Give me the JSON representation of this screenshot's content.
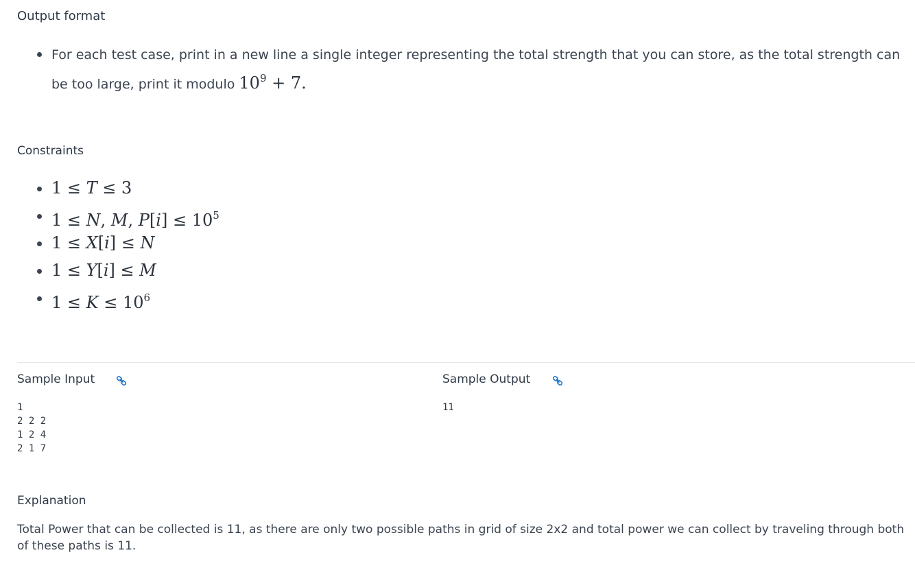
{
  "output_format": {
    "heading": "Output format",
    "bullet_text": "For each test case, print in a new line a single integer representing the total strength that you can store, as the total strength can be too large, print it modulo ",
    "modulo_expr": {
      "base": "10",
      "exponent": "9",
      "rest": " + 7",
      "end": "."
    }
  },
  "constraints": {
    "heading": "Constraints",
    "items": [
      "1 ≤ T ≤ 3",
      "1 ≤ N, M, P[i] ≤ 10^5",
      "1 ≤ X[i] ≤ N",
      "1 ≤ Y[i] ≤ M",
      "1 ≤ K ≤ 10^6"
    ]
  },
  "sample_input": {
    "heading": "Sample Input",
    "icon": "link-icon",
    "content": "1\n2 2 2\n1 2 4\n2 1 7"
  },
  "sample_output": {
    "heading": "Sample Output",
    "icon": "link-icon",
    "content": "11"
  },
  "explanation": {
    "heading": "Explanation",
    "text": "Total Power that can be collected is 11, as there are only two possible paths in grid of size 2x2 and total power we can collect by traveling through both of these paths is 11."
  },
  "colors": {
    "text": "#3b4450",
    "heading": "#2f3a47",
    "link_icon": "#1a73c8",
    "divider": "#e3e6ea"
  }
}
